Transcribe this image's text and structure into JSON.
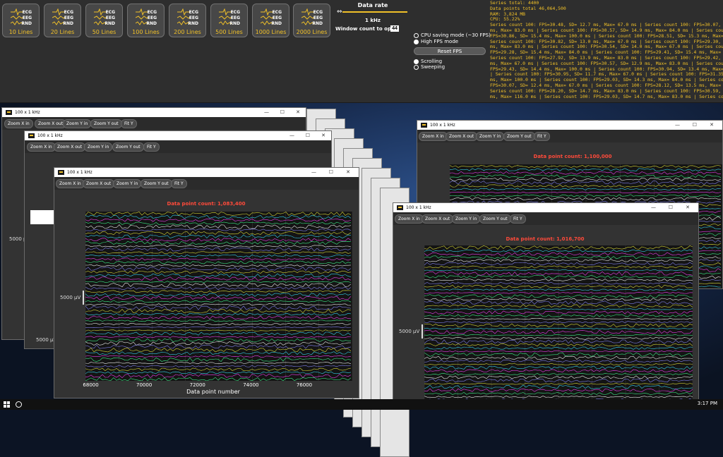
{
  "toolbar": {
    "presets": [
      {
        "label": "10 Lines"
      },
      {
        "label": "20 Lines"
      },
      {
        "label": "50 Lines"
      },
      {
        "label": "100 Lines"
      },
      {
        "label": "200 Lines"
      },
      {
        "label": "500 Lines"
      },
      {
        "label": "1000 Lines"
      },
      {
        "label": "2000 Lines"
      }
    ],
    "icon_text": [
      "ECG",
      "EEG",
      "RND"
    ],
    "data_rate_title": "Data rate",
    "data_rate_value": "1 kHz",
    "window_count_label": "Window count to open",
    "window_count_value": "44",
    "mode_cpu_saving": "CPU saving mode (~30 FPS)",
    "mode_high_fps": "High FPS mode",
    "reset_fps": "Reset FPS",
    "scroll_mode": "Scrolling",
    "sweep_mode": "Sweeping",
    "selected_fps_mode": "High FPS mode",
    "selected_scroll_mode": "Scrolling"
  },
  "stats": {
    "lines": [
      "Series total: 4400",
      "Data points total 46,064,500",
      "RAM: 3,824 MB",
      "CPU: 55.22%",
      "Series count  100: FPS=30.48, SD= 12.7 ms, Max= 67.0 ms | Series count  100: FPS=30.07, SD=",
      "ms, Max= 83.0 ms | Series count  100: FPS=30.57, SD= 14.9 ms, Max= 84.0 ms | Series count  1",
      "FPS=30.86, SD= 15.4 ms, Max= 100.0 ms | Series count  100: FPS=28.51, SD= 15.3 ms, Max= 6",
      "Series count  100: FPS=30.82, SD= 13.0 ms, Max= 67.0 ms | Series count  100: FPS=29.30, SD=",
      "ms, Max= 83.0 ms | Series count  100: FPS=30.54, SD= 14.0 ms, Max= 67.0 ms | Series count",
      "FPS=29.28, SD= 15.4 ms, Max= 84.0 ms | Series count  100: FPS=29.41, SD= 15.4 ms, Max= 8",
      "Series count  100: FPS=27.92, SD= 13.9 ms, Max= 83.0 ms | Series count  100: FPS=29.42, SD=",
      "ms, Max= 67.0 ms | Series count  100: FPS=30.57, SD= 12.9 ms, Max= 83.0 ms | Series count",
      "FPS=29.43, SD= 14.4 ms, Max= 100.0 ms | Series count  100: FPS=30.94, SD= 13.4 ms, Max= 1",
      "| Series count  100: FPS=30.95, SD= 11.7 ms, Max= 67.0 ms | Series count  100: FPS=31.35, SD",
      "ms, Max= 100.0 ms | Series count  100: FPS=29.03, SD= 14.3 ms, Max= 84.0 ms | Series count",
      "FPS=30.07, SD= 12.4 ms, Max= 67.0 ms | Series count  100: FPS=28.12, SD= 13.5 ms, Max= 8",
      "Series count  100: FPS=28.20, SD= 14.7 ms, Max= 83.0 ms | Series count  100: FPS=30.59, SD=",
      "ms, Max= 116.0 ms | Series count  100: FPS=29.03, SD= 14.7 ms, Max= 83.0 ms | Series count"
    ]
  },
  "window_common": {
    "title": "100 x 1 kHz",
    "zoom_x_in": "Zoom X in",
    "zoom_x_out": "Zoom X out",
    "zoom_y_in": "Zoom Y in",
    "zoom_y_out": "Zoom Y out",
    "fit_y": "Fit Y",
    "y_scale": "5000 µV"
  },
  "windows": {
    "front": {
      "count": "Data point count: 1,083,400",
      "x_axis_title": "Data point number"
    },
    "right_top": {
      "count": "Data point count: 1,100,000"
    },
    "right_front": {
      "count": "Data point count: 1,016,700"
    }
  },
  "chart_data": {
    "type": "line",
    "title": "Data point count: 1,083,400",
    "xlabel": "Data point number",
    "ylabel": "5000 µV",
    "xlim": [
      67800,
      77800
    ],
    "x_ticks": [
      68000,
      70000,
      72000,
      74000,
      76000
    ],
    "series_count": 100,
    "grid": true
  },
  "colors": {
    "accent": "#f0c028",
    "count_text": "#ff4a3a",
    "series": [
      "#e8e838",
      "#38e0ff",
      "#ff40ff",
      "#40ff90",
      "#ffffff",
      "#8888ff"
    ]
  },
  "taskbar": {
    "time": "3:17 PM"
  }
}
